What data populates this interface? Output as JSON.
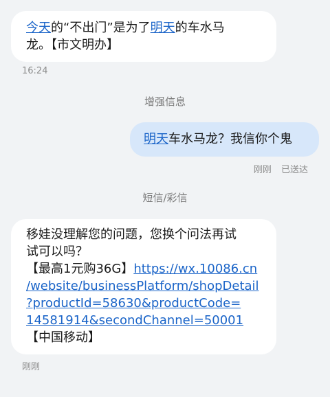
{
  "messages": [
    {
      "direction": "incoming",
      "line1_link1": "今天",
      "line1_text1": "的“不出门”是为了",
      "line1_link2": "明天",
      "line1_text2": "的车水马",
      "line2_text": "龙。【市文明办】",
      "time": "16:24"
    },
    {
      "channel_label": "增强信息",
      "direction": "outgoing",
      "link": "明天",
      "text": "车水马龙？我信你个鬼",
      "status_time": "刚刚",
      "status": "已送达"
    },
    {
      "channel_label": "短信/彩信",
      "direction": "incoming",
      "line1": "移娃没理解您的问题，您换个问法再试",
      "line2": "试可以吗？",
      "line3_text": "【最高1元购36G】",
      "line3_link": "https://wx.10086.cn",
      "line4_link": "/website/businessPlatform/shopDetail",
      "line5_link": "?productId=58630&productCode=",
      "line6_link": "14581914&secondChannel=50001",
      "line7": "【中国移动】",
      "time": "刚刚"
    }
  ],
  "colors": {
    "background": "#f1f3f5",
    "incoming_bubble": "#ffffff",
    "outgoing_bubble": "#d7e7fa",
    "link": "#1a64c8"
  }
}
